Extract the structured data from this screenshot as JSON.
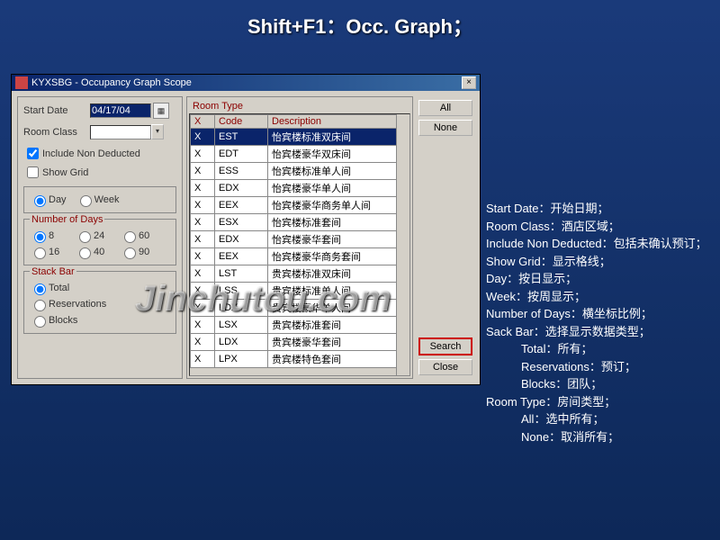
{
  "page_title": "Shift+F1：Occ. Graph；",
  "watermark": "Jinchutou.com",
  "dialog": {
    "title": "KYXSBG - Occupancy Graph Scope",
    "start_date_label": "Start Date",
    "start_date_value": "04/17/04",
    "room_class_label": "Room Class",
    "room_class_value": "",
    "include_label": "Include Non Deducted",
    "include_checked": true,
    "show_grid_label": "Show Grid",
    "show_grid_checked": false,
    "day_label": "Day",
    "week_label": "Week",
    "period_selected": "Day",
    "number_days_label": "Number of Days",
    "days_options": [
      "8",
      "24",
      "60",
      "16",
      "40",
      "90"
    ],
    "days_selected": "8",
    "stack_bar_label": "Stack Bar",
    "stack_options": [
      "Total",
      "Reservations",
      "Blocks"
    ],
    "stack_selected": "Total",
    "room_type_label": "Room Type",
    "cols": {
      "x": "X",
      "code": "Code",
      "desc": "Description"
    },
    "rows": [
      {
        "x": "X",
        "code": "EST",
        "desc": "怡宾楼标准双床间",
        "sel": true
      },
      {
        "x": "X",
        "code": "EDT",
        "desc": "怡宾楼豪华双床间"
      },
      {
        "x": "X",
        "code": "ESS",
        "desc": "怡宾楼标准单人间"
      },
      {
        "x": "X",
        "code": "EDX",
        "desc": "怡宾楼豪华单人间"
      },
      {
        "x": "X",
        "code": "EEX",
        "desc": "怡宾楼豪华商务单人间"
      },
      {
        "x": "X",
        "code": "ESX",
        "desc": "怡宾楼标准套间"
      },
      {
        "x": "X",
        "code": "EDX",
        "desc": "怡宾楼豪华套间"
      },
      {
        "x": "X",
        "code": "EEX",
        "desc": "怡宾楼豪华商务套间"
      },
      {
        "x": "X",
        "code": "LST",
        "desc": "贵宾楼标准双床间"
      },
      {
        "x": "X",
        "code": "LSS",
        "desc": "贵宾楼标准单人间"
      },
      {
        "x": "X",
        "code": "LDX",
        "desc": "贵宾楼豪华单人间"
      },
      {
        "x": "X",
        "code": "LSX",
        "desc": "贵宾楼标准套间"
      },
      {
        "x": "X",
        "code": "LDX",
        "desc": "贵宾楼豪华套间"
      },
      {
        "x": "X",
        "code": "LPX",
        "desc": "贵宾楼特色套间"
      }
    ],
    "btn_all": "All",
    "btn_none": "None",
    "btn_search": "Search",
    "btn_close": "Close"
  },
  "desc_lines": [
    "Start Date：开始日期；",
    "Room Class：酒店区域；",
    "Include Non Deducted：包括未确认预订；",
    "Show Grid：显示格线；",
    "Day：按日显示；",
    "Week：按周显示；",
    "Number of Days：横坐标比例；",
    "Sack Bar：选择显示数据类型；",
    "　　　Total：所有；",
    "　　　Reservations：预订；",
    "　　　Blocks：团队；",
    "Room Type：房间类型；",
    "　　　All：选中所有；",
    "　　　None：取消所有；"
  ]
}
